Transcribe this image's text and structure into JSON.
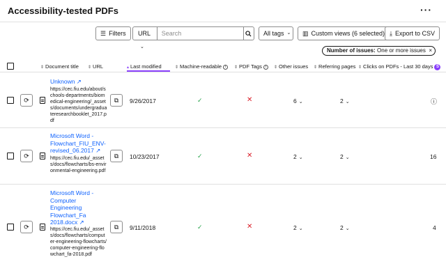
{
  "header": {
    "title": "Accessibility-tested PDFs",
    "more_label": "···"
  },
  "toolbar": {
    "filters_label": "Filters",
    "url_select": "URL",
    "search_placeholder": "Search",
    "tags_select": "All tags",
    "custom_views_label": "Custom views (6 selected)",
    "export_label": "Export to CSV"
  },
  "filter_chip": {
    "label": "Number of issues:",
    "value": "One or more issues",
    "close": "×"
  },
  "columns": {
    "document_title": "Document title",
    "url": "URL",
    "last_modified": "Last modified",
    "machine_readable": "Machine-readable",
    "pdf_tags": "PDF Tags",
    "other_issues": "Other issues",
    "referring_pages": "Referring pages",
    "clicks": "Clicks on PDFs - Last 30 days",
    "clicks_badge": "S"
  },
  "rows": [
    {
      "title": "Unknown ↗",
      "url": "https://cec.fiu.edu/about/schools-departments/biomedical-engineering/_assets/documents/undergraduateresearchbooklet_2017.pdf",
      "last_modified": "9/26/2017",
      "machine_readable": "✓",
      "pdf_tags": "✕",
      "other_issues": "6",
      "referring_pages": "2",
      "clicks": "ⓘ"
    },
    {
      "title": "Microsoft Word - Flowchart_FIU_ENV-revised_06.2017 ↗",
      "url": "https://cec.fiu.edu/_assets/docs/flowcharts/bs-environmental-engineering.pdf",
      "last_modified": "10/23/2017",
      "machine_readable": "✓",
      "pdf_tags": "✕",
      "other_issues": "2",
      "referring_pages": "2",
      "clicks": "16"
    },
    {
      "title": "Microsoft Word - Computer Engineering Flowchart_Fa 2018.docx ↗",
      "url": "https://cec.fiu.edu/_assets/docs/flowcharts/computer-engineering-flowcharts/computer-engineering-flowchart_fa-2018.pdf",
      "last_modified": "9/11/2018",
      "machine_readable": "✓",
      "pdf_tags": "✕",
      "other_issues": "2",
      "referring_pages": "2",
      "clicks": "4"
    }
  ]
}
